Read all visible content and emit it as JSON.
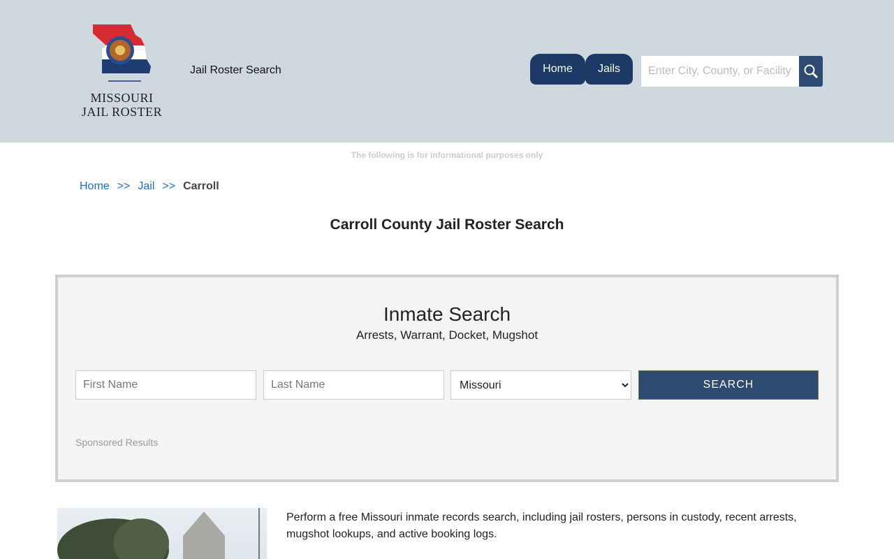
{
  "header": {
    "logo_text": "MISSOURI JAIL ROSTER",
    "site_title": "Jail Roster Search",
    "nav": [
      {
        "label": "Home"
      },
      {
        "label": "Jails"
      }
    ],
    "search_placeholder": "Enter City, County, or Facility"
  },
  "disclaimer": "The following is for informational purposes only",
  "breadcrumb": {
    "items": [
      "Home",
      "Jail"
    ],
    "separator": ">>",
    "current": "Carroll"
  },
  "page_title": "Carroll County Jail Roster Search",
  "inmate_search": {
    "title": "Inmate Search",
    "subtitle": "Arrests, Warrant, Docket, Mugshot",
    "first_name_placeholder": "First Name",
    "last_name_placeholder": "Last Name",
    "state_selected": "Missouri",
    "button": "SEARCH",
    "sponsored": "Sponsored Results"
  },
  "intro": "Perform a free Missouri inmate records search, including jail rosters, persons in custody, recent arrests, mugshot lookups, and active booking logs.",
  "colors": {
    "header_bg": "#cfd7df",
    "nav": "#1d3a66",
    "button": "#2d4a70",
    "link": "#1e6fc9"
  }
}
